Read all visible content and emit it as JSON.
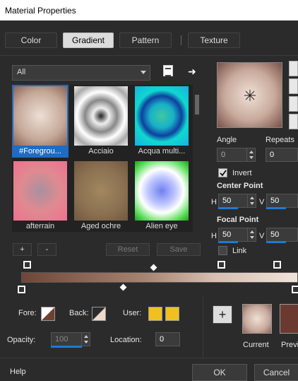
{
  "window": {
    "title": "Material Properties"
  },
  "tabs": [
    {
      "label": "Color"
    },
    {
      "label": "Gradient"
    },
    {
      "label": "Pattern"
    },
    {
      "label": "Texture"
    }
  ],
  "filter": {
    "value": "All"
  },
  "gradients": [
    {
      "label": "#Foregrou...",
      "selected": true
    },
    {
      "label": "Acciaio"
    },
    {
      "label": "Acqua multi..."
    },
    {
      "label": "afterrain"
    },
    {
      "label": "Aged ochre"
    },
    {
      "label": "Alien eye"
    }
  ],
  "buttons": {
    "add": "+",
    "remove": "-",
    "reset": "Reset",
    "save": "Save",
    "ok": "OK",
    "cancel": "Cancel",
    "help": "Help"
  },
  "angle": {
    "label": "Angle",
    "value": "0"
  },
  "repeats": {
    "label": "Repeats",
    "value": "0"
  },
  "invert": {
    "label": "Invert",
    "checked": true
  },
  "center_point": {
    "label": "Center Point",
    "h_label": "H",
    "h": "50",
    "v_label": "V",
    "v": "50"
  },
  "focal_point": {
    "label": "Focal Point",
    "h_label": "H",
    "h": "50",
    "v_label": "V",
    "v": "50"
  },
  "link": {
    "label": "Link",
    "checked": false
  },
  "fore": {
    "label": "Fore:"
  },
  "back": {
    "label": "Back:"
  },
  "user": {
    "label": "User:",
    "color1": "#f0c020",
    "color2": "#f0c020"
  },
  "opacity": {
    "label": "Opacity:",
    "value": "100",
    "level": 1.0
  },
  "location": {
    "label": "Location:",
    "value": "0"
  },
  "current": {
    "label": "Current"
  },
  "previous": {
    "label": "Previ"
  },
  "colors": {
    "accent": "#1e7ad4",
    "selection": "#1f6cc0"
  }
}
